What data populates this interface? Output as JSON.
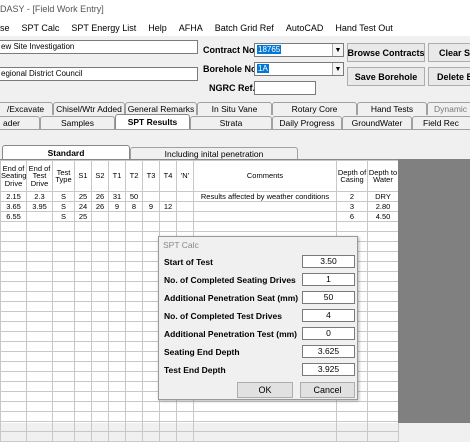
{
  "window": {
    "title": "DASY - [Field Work Entry]"
  },
  "menu": [
    "se",
    "SPT Calc",
    "SPT Energy List",
    "Help",
    "AFHA",
    "Batch Grid Ref",
    "AutoCAD",
    "Hand Test Out"
  ],
  "header": {
    "project_name": "ew Site Investigation",
    "client_name": "egional District Council",
    "contract_label": "Contract No.",
    "contract_value": "18765",
    "borehole_label": "Borehole No.",
    "borehole_value": "1A",
    "ngrc_label": "NGRC Ref.",
    "ngrc_value": "",
    "browse_contracts": "Browse Contracts",
    "clear": "Clear S",
    "save_borehole": "Save Borehole",
    "delete": "Delete B"
  },
  "tabs_row1": [
    "/Excavate",
    "Chisel/Wtr Added",
    "General Remarks",
    "In Situ Vane",
    "Rotary Core",
    "Hand Tests",
    "Dynamic"
  ],
  "tabs_row2": [
    "ader",
    "Samples",
    "SPT Results",
    "Strata",
    "Daily Progress",
    "GroundWater",
    "Field Rec"
  ],
  "sub_tabs": [
    "Standard",
    "Including inital penetration"
  ],
  "grid": {
    "columns": [
      "End of Seating Drive",
      "End of Test Drive",
      "Test Type",
      "S1",
      "S2",
      "T1",
      "T2",
      "T3",
      "T4",
      "'N'",
      "Comments",
      "Depth of Casing",
      "Depth to Water"
    ],
    "rows": [
      [
        "2.15",
        "2.3",
        "S",
        "25",
        "26",
        "31",
        "50",
        "",
        "",
        "",
        "Results affected by weather conditions",
        "2",
        "DRY"
      ],
      [
        "3.65",
        "3.95",
        "S",
        "24",
        "26",
        "9",
        "8",
        "9",
        "12",
        "",
        "",
        "3",
        "2.80"
      ],
      [
        "6.55",
        "",
        "S",
        "25",
        "",
        "",
        "",
        "",
        "",
        "",
        "",
        "6",
        "4.50"
      ]
    ]
  },
  "dialog": {
    "title": "SPT Calc",
    "start_label": "Start of Test",
    "start_value": "3.50",
    "seat_drives_label": "No. of Completed Seating Drives",
    "seat_drives_value": "1",
    "add_pen_seat_label": "Additional Penetration Seat (mm)",
    "add_pen_seat_value": "50",
    "test_drives_label": "No. of Completed Test Drives",
    "test_drives_value": "4",
    "add_pen_test_label": "Additional Penetration Test (mm)",
    "add_pen_test_value": "0",
    "seat_end_label": "Seating End Depth",
    "seat_end_value": "3.625",
    "test_end_label": "Test End Depth",
    "test_end_value": "3.925",
    "ok": "OK",
    "cancel": "Cancel"
  }
}
